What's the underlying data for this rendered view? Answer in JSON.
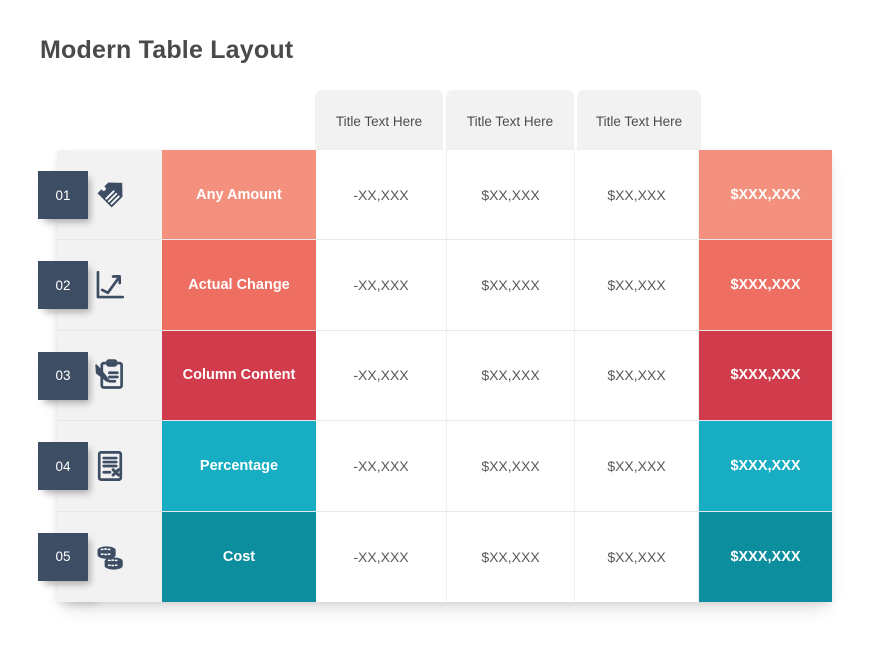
{
  "page": {
    "title": "Modern Table Layout"
  },
  "colors": {
    "badge": "#3d4d63",
    "title_text": "#4a4a4a",
    "header_tab_bg": "#f2f2f2",
    "icon_cell_bg": "#f2f2f2",
    "row_colors": [
      "#f4917e",
      "#ef6e62",
      "#d03c4b",
      "#17aec4",
      "#0d8e9e"
    ]
  },
  "table": {
    "headers": [
      {
        "label": "Title Text Here"
      },
      {
        "label": "Title Text Here"
      },
      {
        "label": "Title Text Here"
      }
    ],
    "rows": [
      {
        "number": "01",
        "icon": "price-tag-icon",
        "label": "Any Amount",
        "color": "#f4917e",
        "values": [
          "-XX,XXX",
          "$XX,XXX",
          "$XX,XXX"
        ],
        "total": "$XXX,XXX"
      },
      {
        "number": "02",
        "icon": "line-chart-icon",
        "label": "Actual Change",
        "color": "#ef6e62",
        "values": [
          "-XX,XXX",
          "$XX,XXX",
          "$XX,XXX"
        ],
        "total": "$XXX,XXX"
      },
      {
        "number": "03",
        "icon": "clipboard-pencil-icon",
        "label": "Column Content",
        "color": "#d03c4b",
        "values": [
          "-XX,XXX",
          "$XX,XXX",
          "$XX,XXX"
        ],
        "total": "$XXX,XXX"
      },
      {
        "number": "04",
        "icon": "document-x-icon",
        "label": "Percentage",
        "color": "#17aec4",
        "values": [
          "-XX,XXX",
          "$XX,XXX",
          "$XX,XXX"
        ],
        "total": "$XXX,XXX"
      },
      {
        "number": "05",
        "icon": "coins-stack-icon",
        "label": "Cost",
        "color": "#0d8e9e",
        "values": [
          "-XX,XXX",
          "$XX,XXX",
          "$XX,XXX"
        ],
        "total": "$XXX,XXX"
      }
    ]
  }
}
